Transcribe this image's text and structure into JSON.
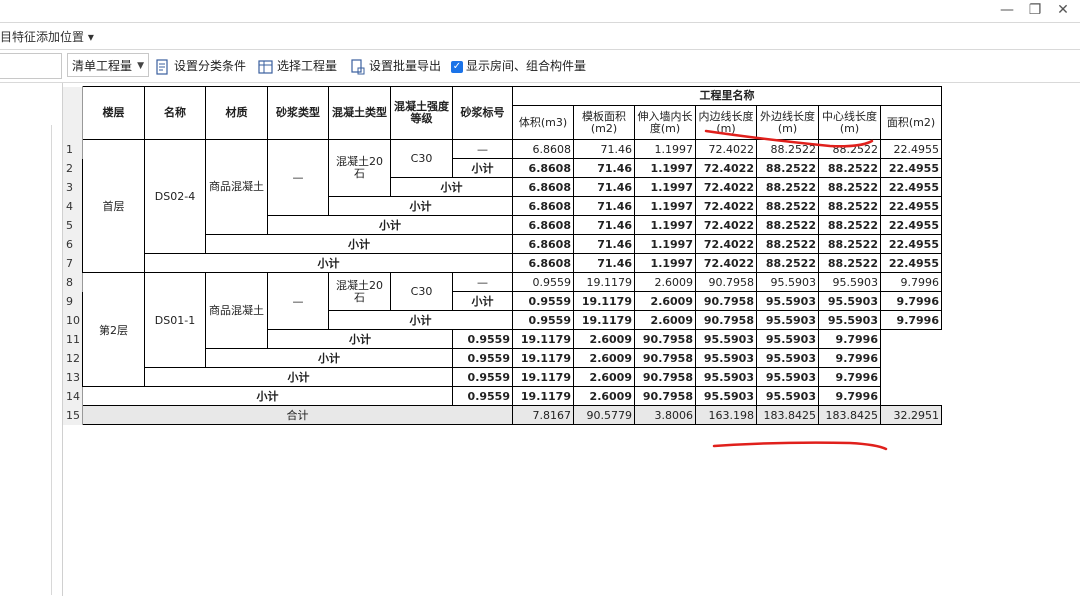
{
  "window": {
    "minimize_glyph": "—",
    "restore_glyph": "❐",
    "close_glyph": "✕"
  },
  "hint": {
    "text": "目特征添加位置 ▾"
  },
  "toolbar": {
    "qty_mode": "清单工程量",
    "btn_set_classify": "设置分类条件",
    "btn_select_qty": "选择工程量",
    "btn_batch_export": "设置批量导出",
    "chk_show_rooms": "显示房间、组合构件量",
    "chk_show_rooms_checked": true
  },
  "table": {
    "headers": {
      "floor": "楼层",
      "name": "名称",
      "material": "材质",
      "mortar_type": "砂浆类型",
      "concrete_type": "混凝土类型",
      "concrete_grade": "混凝土强度等级",
      "mortar_mark": "砂浆标号",
      "qty_group": "工程里名称",
      "volume": "体积(m3)",
      "formwork": "模板面积(m2)",
      "extend_len": "伸入墙内长度(m)",
      "inner_len": "内边线长度(m)",
      "outer_len": "外边线长度(m)",
      "center_len": "中心线长度(m)",
      "area": "面积(m2)"
    },
    "row_numbers": [
      "1",
      "2",
      "3",
      "4",
      "5",
      "6",
      "7",
      "8",
      "9",
      "10",
      "11",
      "12",
      "13",
      "14",
      "15"
    ],
    "floor1": {
      "floor": "首层",
      "name": "DS02-4",
      "material": "商品混凝土",
      "mortar_type": "—",
      "concrete_type": "混凝土20石",
      "concrete_grade": "C30",
      "mortar_mark": "—",
      "detail": [
        "6.8608",
        "71.46",
        "1.1997",
        "72.4022",
        "88.2522",
        "88.2522",
        "22.4955"
      ],
      "subtotal": [
        "6.8608",
        "71.46",
        "1.1997",
        "72.4022",
        "88.2522",
        "88.2522",
        "22.4955"
      ]
    },
    "floor2": {
      "floor": "第2层",
      "name": "DS01-1",
      "material": "商品混凝土",
      "mortar_type": "—",
      "concrete_type": "混凝土20石",
      "concrete_grade": "C30",
      "mortar_mark": "—",
      "detail": [
        "0.9559",
        "19.1179",
        "2.6009",
        "90.7958",
        "95.5903",
        "95.5903",
        "9.7996"
      ],
      "subtotal": [
        "0.9559",
        "19.1179",
        "2.6009",
        "90.7958",
        "95.5903",
        "95.5903",
        "9.7996"
      ]
    },
    "subtotal_label": "小计",
    "total_label": "合计",
    "total": [
      "7.8167",
      "90.5779",
      "3.8006",
      "163.198",
      "183.8425",
      "183.8425",
      "32.2951"
    ]
  },
  "annotation": {
    "color": "#e0201c"
  }
}
